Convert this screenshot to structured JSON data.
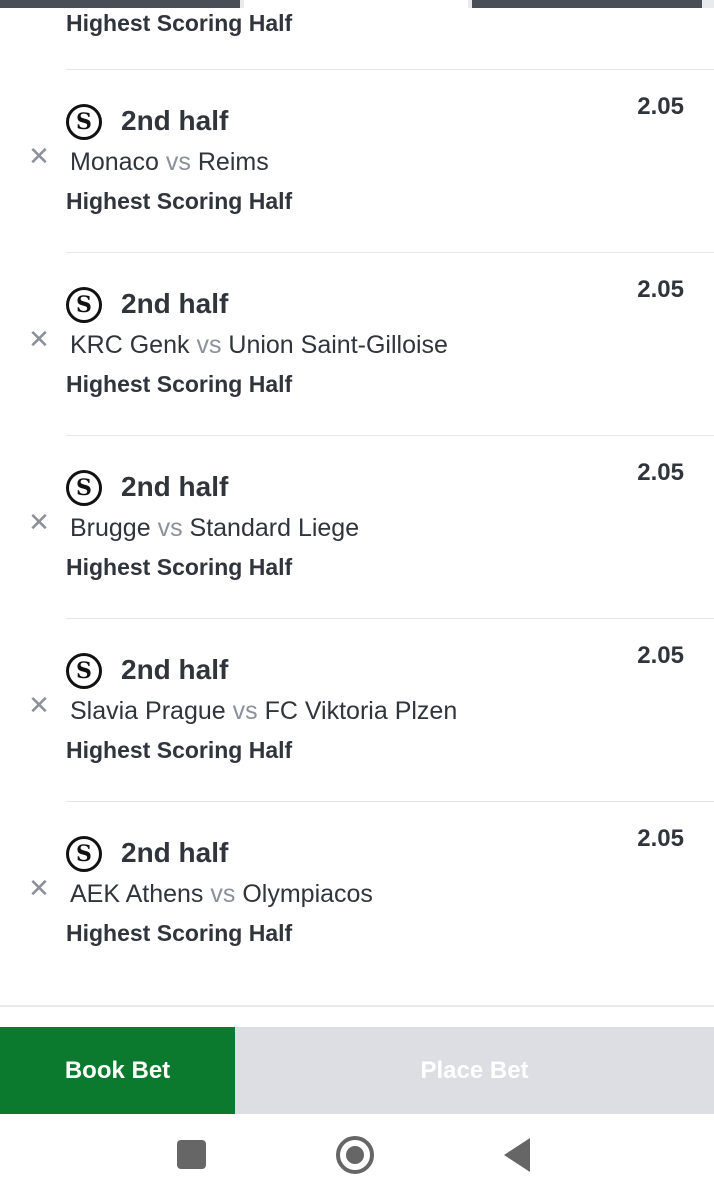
{
  "partial_item": {
    "market": "Highest Scoring Half"
  },
  "bets": [
    {
      "icon": "sportybet-s-icon",
      "selection": "2nd half",
      "home": "Monaco",
      "vs": "vs",
      "away": "Reims",
      "market": "Highest Scoring Half",
      "odds": "2.05"
    },
    {
      "icon": "sportybet-s-icon",
      "selection": "2nd half",
      "home": "KRC Genk",
      "vs": "vs",
      "away": "Union Saint-Gilloise",
      "market": "Highest Scoring Half",
      "odds": "2.05"
    },
    {
      "icon": "sportybet-s-icon",
      "selection": "2nd half",
      "home": "Brugge",
      "vs": "vs",
      "away": "Standard Liege",
      "market": "Highest Scoring Half",
      "odds": "2.05"
    },
    {
      "icon": "sportybet-s-icon",
      "selection": "2nd half",
      "home": "Slavia Prague",
      "vs": "vs",
      "away": "FC Viktoria Plzen",
      "market": "Highest Scoring Half",
      "odds": "2.05"
    },
    {
      "icon": "sportybet-s-icon",
      "selection": "2nd half",
      "home": "AEK Athens",
      "vs": "vs",
      "away": "Olympiacos",
      "market": "Highest Scoring Half",
      "odds": "2.05"
    }
  ],
  "icon_glyph": "S",
  "remove_glyph": "✕",
  "actions": {
    "book_bet": "Book Bet",
    "place_bet": "Place Bet"
  },
  "colors": {
    "book_bet_bg": "#0b7a2f",
    "place_bet_bg": "#dcdee3",
    "text": "#30343b",
    "muted": "#8c9098"
  },
  "nav": {
    "recents": "square-icon",
    "home": "circle-home-icon",
    "back": "triangle-back-icon"
  }
}
